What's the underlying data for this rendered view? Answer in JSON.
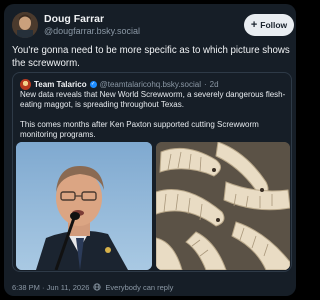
{
  "post": {
    "author_name": "Doug Farrar",
    "author_handle": "@dougfarrar.bsky.social",
    "follow_label": "Follow",
    "follow_icon": "plus-icon",
    "text": "You're gonna need to be more specific as to which picture shows the screwworm.",
    "timestamp": "6:38 PM · Jun 11, 2026",
    "reply_setting": "Everybody can reply"
  },
  "quote": {
    "author_name": "Team Talarico",
    "author_handle": "@teamtalaricohq.bsky.social",
    "separator": "·",
    "age": "2d",
    "paragraph1": "New data reveals that New World Screwworm, a severely dangerous flesh-eating maggot, is spreading throughout Texas.",
    "paragraph2": "This comes months after Ken Paxton supported cutting Screwworm monitoring programs."
  },
  "colors": {
    "background": "#000000",
    "card": "#161e27",
    "text": "#f1f3f5",
    "muted": "#8b98a5",
    "verified": "#1d8cff",
    "follow_button": "#e9edf1"
  }
}
